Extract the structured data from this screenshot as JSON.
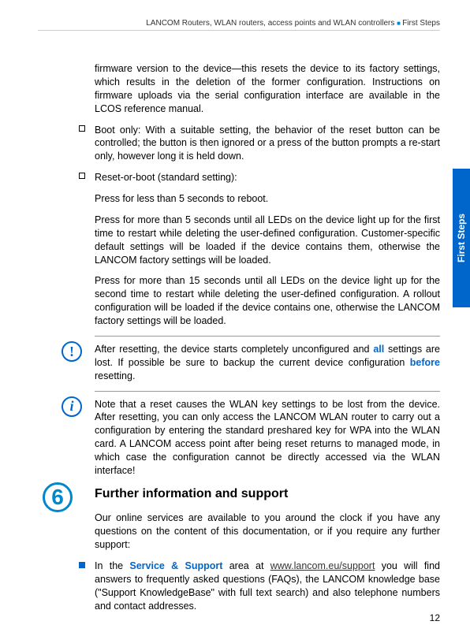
{
  "header": {
    "text_left": "LANCOM Routers, WLAN routers, access points and WLAN controllers",
    "text_right": "First Steps"
  },
  "side_tab": "First Steps",
  "intro_para": "firmware version to the device—this resets the device to its factory settings, which results in the deletion of the former configuration. Instructions on firmware uploads via the serial configuration interface are available in the LCOS reference manual.",
  "bullets": [
    {
      "text": "Boot only: With a suitable setting, the behavior of the reset button can be controlled; the button is then ignored or a press of the button prompts a re-start only, however long it is held down."
    },
    {
      "text": "Reset-or-boot (standard setting):",
      "subs": [
        "Press for less than 5 seconds to reboot.",
        "Press for more than 5 seconds until all LEDs on the device light up for the first time to restart while deleting the user-defined configuration. Customer-specific default settings will be loaded if the device contains them, otherwise the LANCOM factory settings will be loaded.",
        "Press for more than 15 seconds until all LEDs on the device light up for the second time to restart while deleting the user-defined configuration. A rollout configuration will be loaded if the device contains one, otherwise the LANCOM factory settings will be loaded."
      ]
    }
  ],
  "warning_note": {
    "pre": "After resetting, the device starts completely unconfigured and ",
    "emph1": "all",
    "mid": " settings are lost. If possible be sure to backup the current device configuration ",
    "emph2": "before",
    "post": " resetting."
  },
  "info_note": "Note that a reset causes the WLAN key settings to be lost from the device. After resetting, you can only access the LANCOM WLAN router to carry out a configuration by entering the standard preshared key for WPA into the WLAN card. A LANCOM access point after being reset returns to managed mode, in which case the configuration cannot be directly accessed via the WLAN interface!",
  "section": {
    "number": "6",
    "title": "Further information and support"
  },
  "support_intro": "Our online services are available to you around the clock if you have any questions on the content of this documentation, or if you require any further support:",
  "support_item": {
    "pre": "In the ",
    "bold": "Service & Support",
    "mid": " area at ",
    "link": "www.lancom.eu/support",
    "post": " you will find answers to frequently asked questions (FAQs), the LANCOM knowledge base (\"Support KnowledgeBase\" with full text search) and also telephone numbers and contact addresses."
  },
  "page_number": "12"
}
